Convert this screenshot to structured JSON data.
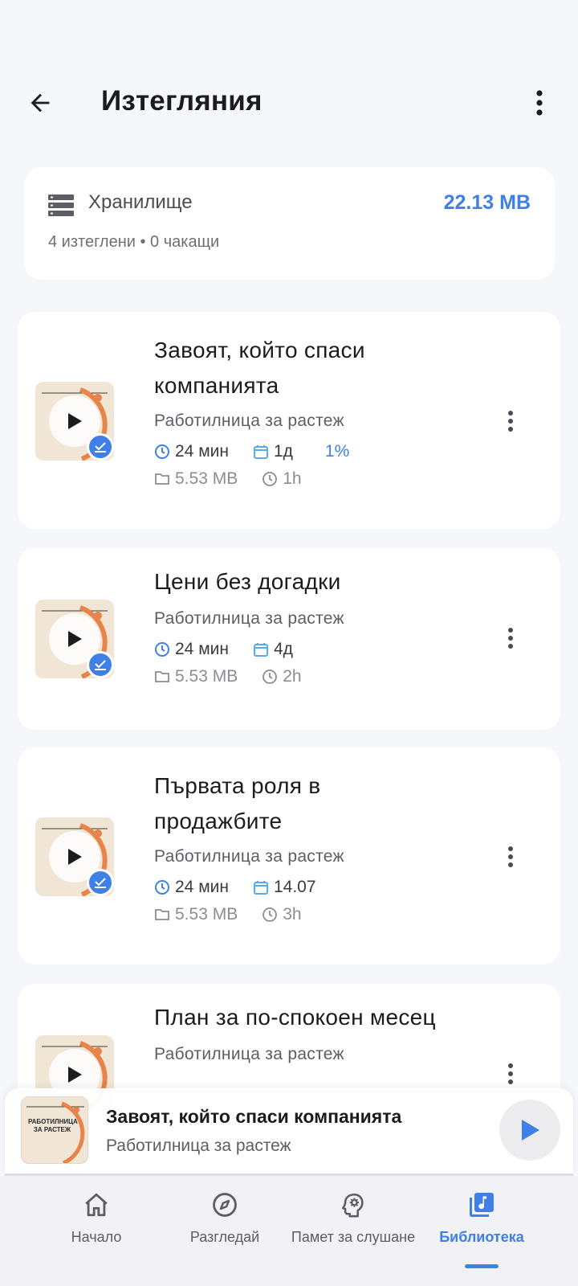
{
  "header": {
    "title": "Изтегляния"
  },
  "storage": {
    "label": "Хранилище",
    "size": "22.13 MB",
    "summary": "4 изтеглени • 0 чакащи"
  },
  "episodes": [
    {
      "title": "Завоят, който спаси компанията",
      "show": "Работилница за растеж",
      "duration": "24 мин",
      "date": "1д",
      "progress": "1%",
      "file_size": "5.53 MB",
      "downloaded_ago": "1h"
    },
    {
      "title": "Цени без догадки",
      "show": "Работилница за растеж",
      "duration": "24 мин",
      "date": "4д",
      "file_size": "5.53 MB",
      "downloaded_ago": "2h"
    },
    {
      "title": "Първата роля в продажбите",
      "show": "Работилница за растеж",
      "duration": "24 мин",
      "date": "14.07",
      "file_size": "5.53 MB",
      "downloaded_ago": "3h"
    },
    {
      "title": "План за по-спокоен месец",
      "show": "Работилница за растеж"
    }
  ],
  "mini_player": {
    "title": "Завоят, който спаси компанията",
    "show": "Работилница за растеж",
    "art_text": "РАБОТИЛНИЦА ЗА РАСТЕЖ"
  },
  "nav": {
    "items": [
      {
        "label": "Начало",
        "icon": "home-icon"
      },
      {
        "label": "Разгледай",
        "icon": "compass-icon"
      },
      {
        "label": "Памет за слушане",
        "icon": "brain-icon"
      },
      {
        "label": "Библиотека",
        "icon": "library-icon",
        "active": true
      }
    ]
  },
  "colors": {
    "accent": "#3f7fe6",
    "background": "#f6f7fa",
    "card": "#ffffff",
    "thumb_bg": "#f1e5d6",
    "thumb_arc": "#e8844a"
  }
}
